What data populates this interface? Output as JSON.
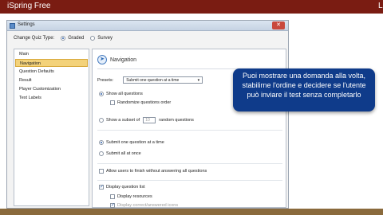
{
  "app": {
    "title": "iSpring Free",
    "edge_letter": "L"
  },
  "dialog": {
    "title": "Settings",
    "close_glyph": "✕",
    "quiz_type": {
      "label": "Change Quiz Type:",
      "options": [
        "Graded",
        "Survey"
      ],
      "selected": "Graded"
    }
  },
  "sidebar": {
    "items": [
      {
        "label": "Main"
      },
      {
        "label": "Navigation"
      },
      {
        "label": "Question Defaults"
      },
      {
        "label": "Result"
      },
      {
        "label": "Player Customization"
      },
      {
        "label": "Text Labels"
      }
    ],
    "selected": "Navigation"
  },
  "panel": {
    "title": "Navigation",
    "presets": {
      "label": "Presets:",
      "value": "Submit one question at a time"
    },
    "show_all": "Show all questions",
    "randomize": "Randomize questions order",
    "subset": {
      "prefix": "Show a subset of",
      "count": "10",
      "suffix": "random questions"
    },
    "submit_one": "Submit one question at a time",
    "submit_all": "Submit all at once",
    "allow_finish": "Allow users to finish without answering all questions",
    "display_list": "Display question list",
    "display_resources": "Display resources",
    "display_cut": "Display correct/answered icons"
  },
  "overlay": {
    "text": "Puoi mostrare una domanda alla volta, stabilirne l'ordine e decidere se l'utente può inviare il test senza completarlo"
  },
  "colors": {
    "top_bar": "#7a1c12",
    "selected_item": "#f3d27a",
    "overlay_bg": "#0f3b8a"
  }
}
